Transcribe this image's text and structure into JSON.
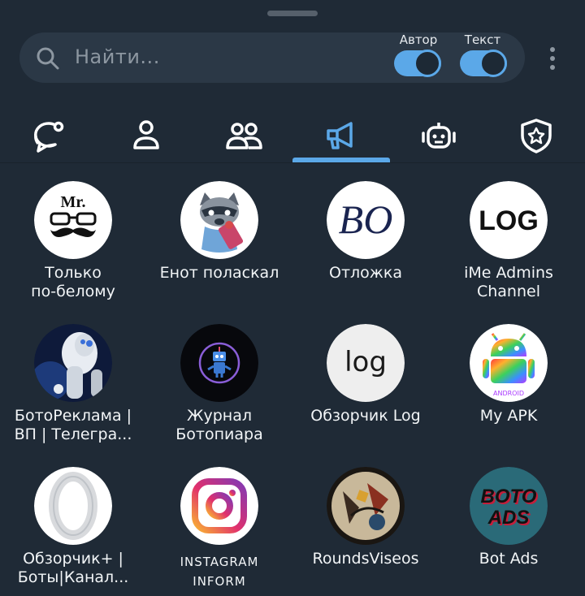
{
  "search": {
    "placeholder": "Найти..."
  },
  "toggles": [
    {
      "label": "Автор",
      "on": true
    },
    {
      "label": "Текст",
      "on": true
    }
  ],
  "tabs": [
    {
      "icon": "chat-bubble-icon",
      "selected": false
    },
    {
      "icon": "person-icon",
      "selected": false
    },
    {
      "icon": "people-icon",
      "selected": false
    },
    {
      "icon": "megaphone-icon",
      "selected": true
    },
    {
      "icon": "bot-icon",
      "selected": false
    },
    {
      "icon": "shield-star-icon",
      "selected": false
    }
  ],
  "channels": [
    {
      "line1": "Только",
      "line2": "по-белому",
      "avatar": "mr-mustache-avatar"
    },
    {
      "line1": "Енот поласкал",
      "line2": "",
      "avatar": "raccoon-avatar"
    },
    {
      "line1": "Отложка",
      "line2": "",
      "avatar": "bo-logo-avatar"
    },
    {
      "line1": "iMe Admins",
      "line2": "Channel",
      "avatar": "log-logo-avatar"
    },
    {
      "line1": "БотоРеклама |",
      "line2": "ВП | Телегра...",
      "avatar": "robot-photo-avatar"
    },
    {
      "line1": "Журнал",
      "line2": "Ботопиара",
      "avatar": "neon-robot-avatar"
    },
    {
      "line1": "Обзорчик Log",
      "line2": "",
      "avatar": "log-round-avatar"
    },
    {
      "line1": "My APK",
      "line2": "",
      "avatar": "rainbow-android-avatar"
    },
    {
      "line1": "Обзорчик+ |",
      "line2": "Боты|Канал...",
      "avatar": "opera-o-avatar"
    },
    {
      "line1": "INSTAGRAM",
      "line2": "INFORM",
      "avatar": "instagram-avatar"
    },
    {
      "line1": "RoundsViseos",
      "line2": "",
      "avatar": "art-collage-avatar"
    },
    {
      "line1": "Bot Ads",
      "line2": "",
      "avatar": "boto-ads-avatar"
    }
  ],
  "boto_ads_text": [
    "BOTO",
    "ADS"
  ],
  "avatar_texts": {
    "mr": "Mr.",
    "bo": "BO",
    "log_caps": "LOG",
    "log_lower": "log",
    "apk_caption": "ANDROID"
  },
  "colors": {
    "background": "#1f2a36",
    "search_bg": "#2b3846",
    "accent": "#5ba8e8",
    "muted_text": "#8d97a1"
  }
}
